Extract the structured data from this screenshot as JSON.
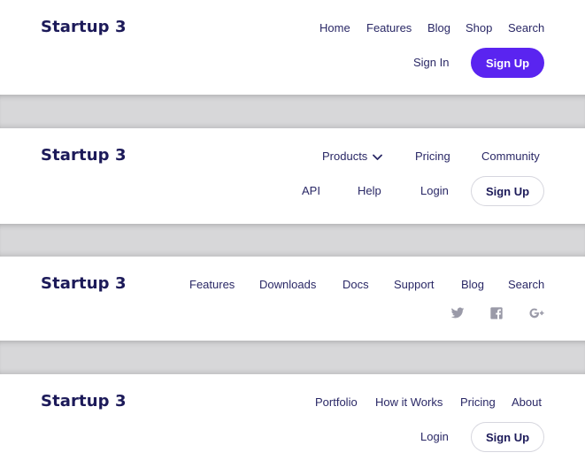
{
  "colors": {
    "brand": "#1c1a59",
    "accent": "#5a24f0",
    "link": "#2a2866",
    "social": "#9a9aa8",
    "separator": "#d7d7d9"
  },
  "header1": {
    "logo": "Startup 3",
    "nav": [
      "Home",
      "Features",
      "Blog",
      "Shop",
      "Search"
    ],
    "sign_in": "Sign In",
    "sign_up": "Sign Up"
  },
  "header2": {
    "logo": "Startup 3",
    "products": "Products",
    "nav": [
      "Pricing",
      "Community"
    ],
    "nav2": [
      "API",
      "Help",
      "Login"
    ],
    "sign_up": "Sign Up"
  },
  "header3": {
    "logo": "Startup 3",
    "nav": [
      "Features",
      "Downloads",
      "Docs",
      "Support",
      "Blog",
      "Search"
    ],
    "social_icons": [
      "twitter-icon",
      "facebook-icon",
      "google-plus-icon"
    ]
  },
  "header4": {
    "logo": "Startup 3",
    "nav": [
      "Portfolio",
      "How it Works",
      "Pricing",
      "About"
    ],
    "login": "Login",
    "sign_up": "Sign Up"
  }
}
